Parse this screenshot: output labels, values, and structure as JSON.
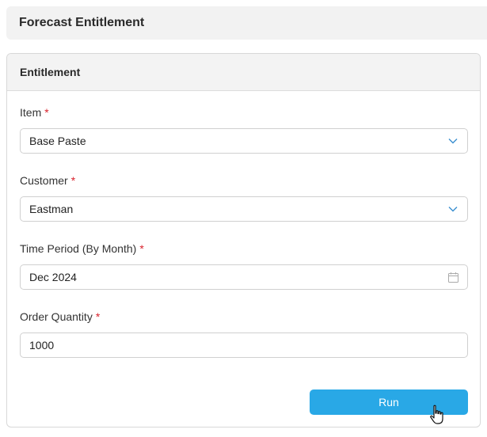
{
  "header": {
    "title": "Forecast Entitlement"
  },
  "card": {
    "title": "Entitlement"
  },
  "fields": {
    "item": {
      "label": "Item",
      "required_mark": "*",
      "value": "Base Paste",
      "icon": "chevron-down-icon"
    },
    "customer": {
      "label": "Customer",
      "required_mark": "*",
      "value": "Eastman",
      "icon": "chevron-down-icon"
    },
    "time_period": {
      "label": "Time Period (By Month)",
      "required_mark": "*",
      "value": "Dec 2024",
      "icon": "calendar-icon"
    },
    "order_quantity": {
      "label": "Order Quantity",
      "required_mark": "*",
      "value": "1000"
    }
  },
  "actions": {
    "run_label": "Run"
  },
  "colors": {
    "accent": "#29a8e6",
    "required": "#d9232d",
    "chevron": "#3a8fd0"
  }
}
